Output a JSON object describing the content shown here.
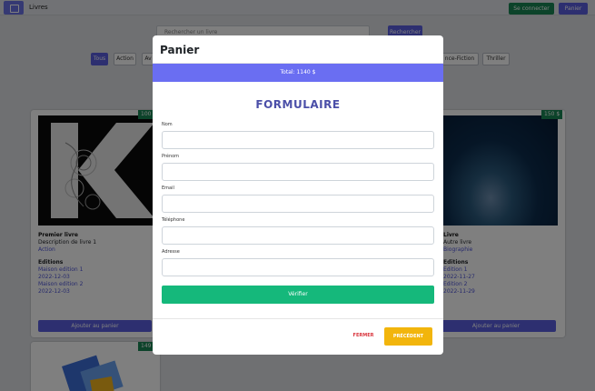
{
  "navbar": {
    "brand": "Livres",
    "login_label": "Se connecter",
    "cart_label": "Panier"
  },
  "search": {
    "placeholder": "Rechercher un livre",
    "button_label": "Rechercher"
  },
  "filters": [
    "Tous",
    "Action",
    "Av",
    "nce-Fiction",
    "Thriller"
  ],
  "books": [
    {
      "price": "100",
      "title": "Premier livre",
      "description": "Description de livre 1",
      "category": "Action",
      "editions_heading": "Editions",
      "editions": [
        "Maison edition 1",
        "2022-12-03",
        "Maison edition 2",
        "2022-12-03"
      ],
      "add_label": "Ajouter au panier"
    },
    {
      "price": "150 $",
      "title": "Livre",
      "description": "Autre livre",
      "category": "Biographie",
      "editions_heading": "Editions",
      "editions": [
        "Edition 1",
        "2022-11-27",
        "Edition 2",
        "2022-11-29"
      ],
      "add_label": "Ajouter au panier"
    },
    {
      "price": "149"
    }
  ],
  "modal": {
    "title": "Panier",
    "total": "Total: 1140 $",
    "form_title": "FORMULAIRE",
    "fields": [
      {
        "label": "Nom",
        "value": ""
      },
      {
        "label": "Prénom",
        "value": ""
      },
      {
        "label": "Email",
        "value": ""
      },
      {
        "label": "Téléphone",
        "value": ""
      },
      {
        "label": "Adresse",
        "value": ""
      }
    ],
    "verify_label": "Vérifier",
    "close_label": "FERMER",
    "previous_label": "PRÉCÉDENT"
  },
  "colors": {
    "primary": "#5a5fe0",
    "success": "#198754",
    "total_bar": "#6a6ef2",
    "verify": "#15b87b",
    "previous": "#f2b50c",
    "close_text": "#d9363e"
  }
}
